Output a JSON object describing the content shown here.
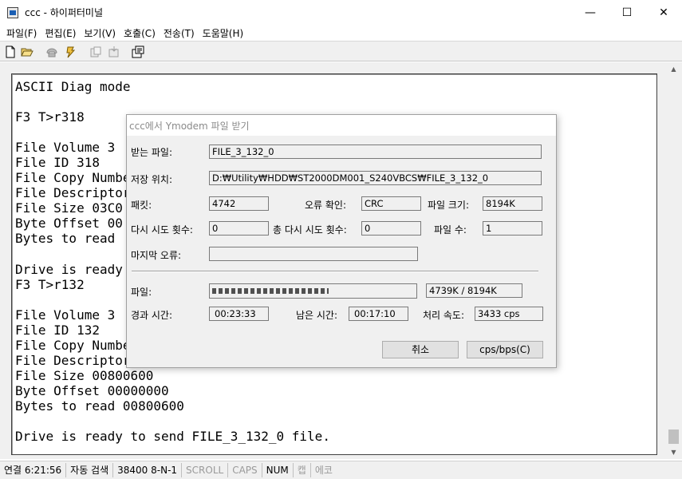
{
  "window": {
    "title": "ccc - 하이퍼터미널",
    "minimize_glyph": "—",
    "maximize_glyph": "☐",
    "close_glyph": "✕"
  },
  "menu": [
    "파일(F)",
    "편집(E)",
    "보기(V)",
    "호출(C)",
    "전송(T)",
    "도움말(H)"
  ],
  "toolbar": {
    "icons": [
      "new-document-icon",
      "open-folder-icon",
      "phone-connect-icon",
      "phone-disconnect-icon",
      "send-file-icon",
      "receive-file-icon",
      "properties-icon"
    ]
  },
  "terminal": {
    "lines": [
      "ASCII Diag mode",
      "",
      "F3 T>r318",
      "",
      "File Volume 3",
      "File ID 318",
      "File Copy Number",
      "File Descriptor",
      "File Size 03C0",
      "Byte Offset 00",
      "Bytes to read",
      "",
      "Drive is ready",
      "F3 T>r132",
      "",
      "File Volume 3",
      "File ID 132",
      "File Copy Number",
      "File Descriptor",
      "File Size 00800600",
      "Byte Offset 00000000",
      "Bytes to read 00800600",
      "",
      "Drive is ready to send FILE_3_132_0 file."
    ]
  },
  "dialog": {
    "title": "ccc에서 Ymodem 파일 받기",
    "receive_file_label": "받는 파일:",
    "receive_file_value": "FILE_3_132_0",
    "save_location_label": "저장 위치:",
    "save_location_value": "D:₩Utility₩HDD₩ST2000DM001_S240VBCS₩FILE_3_132_0",
    "packet_label": "패킷:",
    "packet_value": "4742",
    "error_check_label": "오류 확인:",
    "error_check_value": "CRC",
    "file_size_label": "파일 크기:",
    "file_size_value": "8194K",
    "retries_label": "다시 시도 횟수:",
    "retries_value": "0",
    "total_retries_label": "총 다시 시도 횟수:",
    "total_retries_value": "0",
    "file_count_label": "파일 수:",
    "file_count_value": "1",
    "last_error_label": "마지막 오류:",
    "last_error_value": "",
    "file_progress_label": "파일:",
    "file_progress_fraction": 0.578,
    "file_progress_text": "4739K / 8194K",
    "elapsed_label": "경과 시간:",
    "elapsed_value": "00:23:33",
    "remaining_label": "남은 시간:",
    "remaining_value": "00:17:10",
    "throughput_label": "처리 속도:",
    "throughput_value": "3433 cps",
    "cancel_button": "취소",
    "unit_button": "cps/bps(C)"
  },
  "status_bar": {
    "connection": "연결 6:21:56",
    "detect": "자동 검색",
    "port_settings": "38400 8-N-1",
    "scroll": "SCROLL",
    "caps": "CAPS",
    "num": "NUM",
    "capture": "캡",
    "echo": "에코"
  }
}
